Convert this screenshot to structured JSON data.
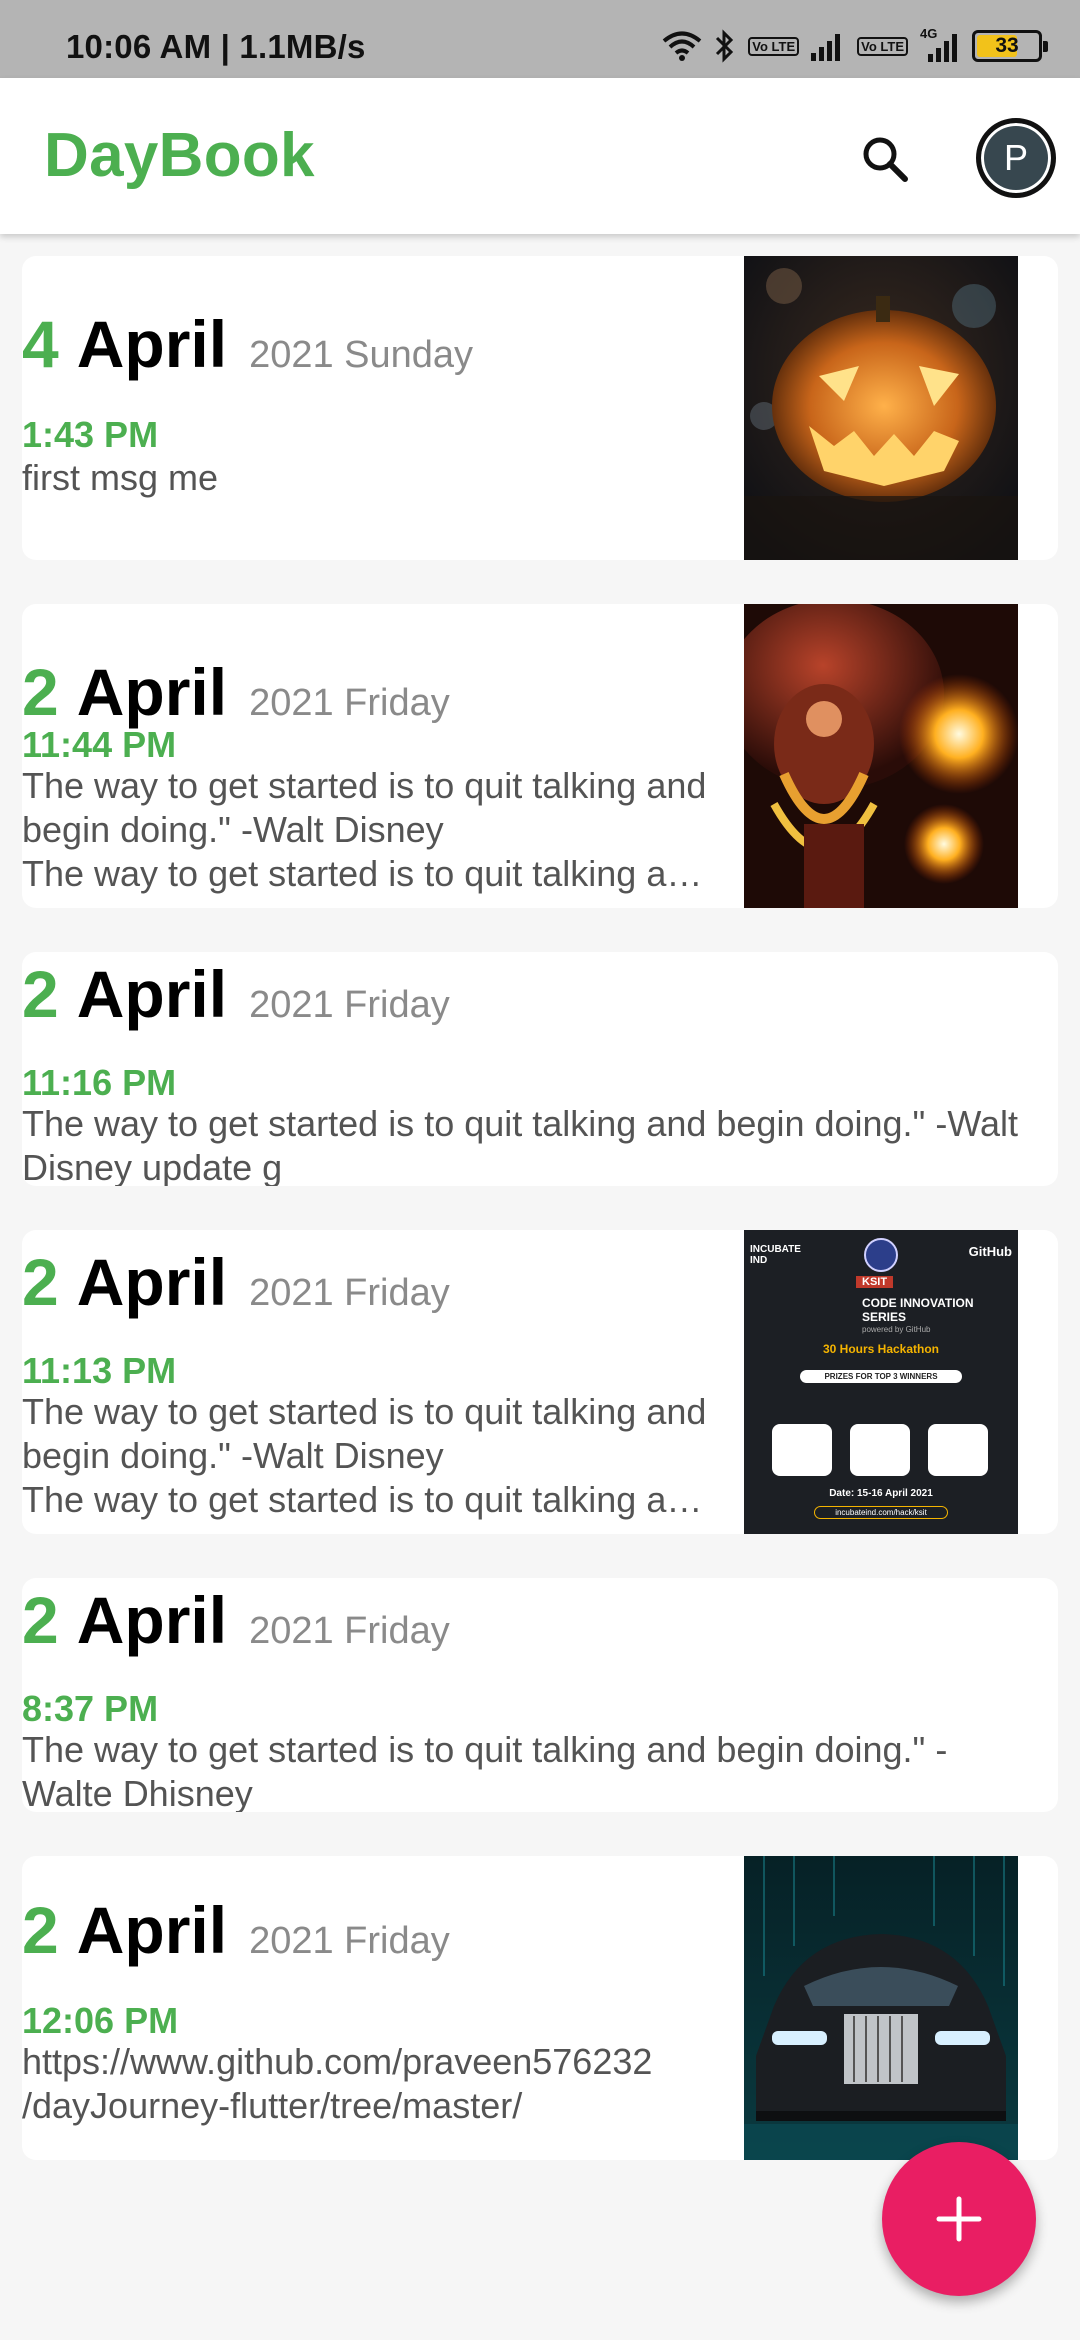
{
  "status_bar": {
    "time": "10:06 AM | 1.1MB/s",
    "battery": "33",
    "lte1": "Vo LTE",
    "lte2": "Vo LTE",
    "network": "4G",
    "icons": [
      "wifi-icon",
      "bluetooth-icon",
      "volte-icon",
      "signal-icon",
      "volte-icon",
      "4g-signal-icon",
      "battery-icon"
    ]
  },
  "app_bar": {
    "title": "DayBook",
    "search_icon": "search-icon",
    "avatar_letter": "P"
  },
  "colors": {
    "accent": "#4caf50",
    "fab": "#e91e63",
    "secondary_text": "#8a8a8a"
  },
  "entries": [
    {
      "day": "4",
      "month": "April",
      "year_weekday": "2021 Sunday",
      "time": "1:43 PM",
      "text": "first msg me",
      "image": "jack-o-lantern-photo"
    },
    {
      "day": "2",
      "month": "April",
      "year_weekday": "2021 Friday",
      "time": "11:44 PM",
      "text": "The way to get started is to quit talking and begin doing.\" -Walt Disney\nThe way to get started is to quit talking and begin doing.\" -Walt Disney",
      "image": "theyyam-fire-photo"
    },
    {
      "day": "2",
      "month": "April",
      "year_weekday": "2021 Friday",
      "time": "11:16 PM",
      "text": "The way to get started is to quit talking and begin doing.\" -Walt Disney update g",
      "image": ""
    },
    {
      "day": "2",
      "month": "April",
      "year_weekday": "2021 Friday",
      "time": "11:13 PM",
      "text": "The way to get started is to quit talking and begin doing.\" -Walt Disney\nThe way to get started is to quit talking and begin doing.\" -Walt Disney",
      "image": "hackathon-poster"
    },
    {
      "day": "2",
      "month": "April",
      "year_weekday": "2021 Friday",
      "time": "8:37 PM",
      "text": "The way to get started is to quit talking and begin doing.\" -Walte Dhisney",
      "image": ""
    },
    {
      "day": "2",
      "month": "April",
      "year_weekday": "2021 Friday",
      "time": "12:06 PM",
      "text": "https://www.github.com/praveen576232\n/dayJourney-flutter/tree/master/",
      "image": "rolls-royce-photo"
    }
  ],
  "poster": {
    "brand_left": "INCUBATE IND",
    "brand_right": "GitHub",
    "college": "KSIT",
    "series_line1": "CODE INNOVATION",
    "series_line2": "SERIES",
    "powered": "powered by GitHub",
    "event": "30 Hours Hackathon",
    "prizes": "PRIZES FOR TOP 3 WINNERS",
    "date": "Date: 15-16 April 2021",
    "url": "incubateind.com/hack/ksit"
  },
  "fab": {
    "icon": "plus-icon"
  }
}
